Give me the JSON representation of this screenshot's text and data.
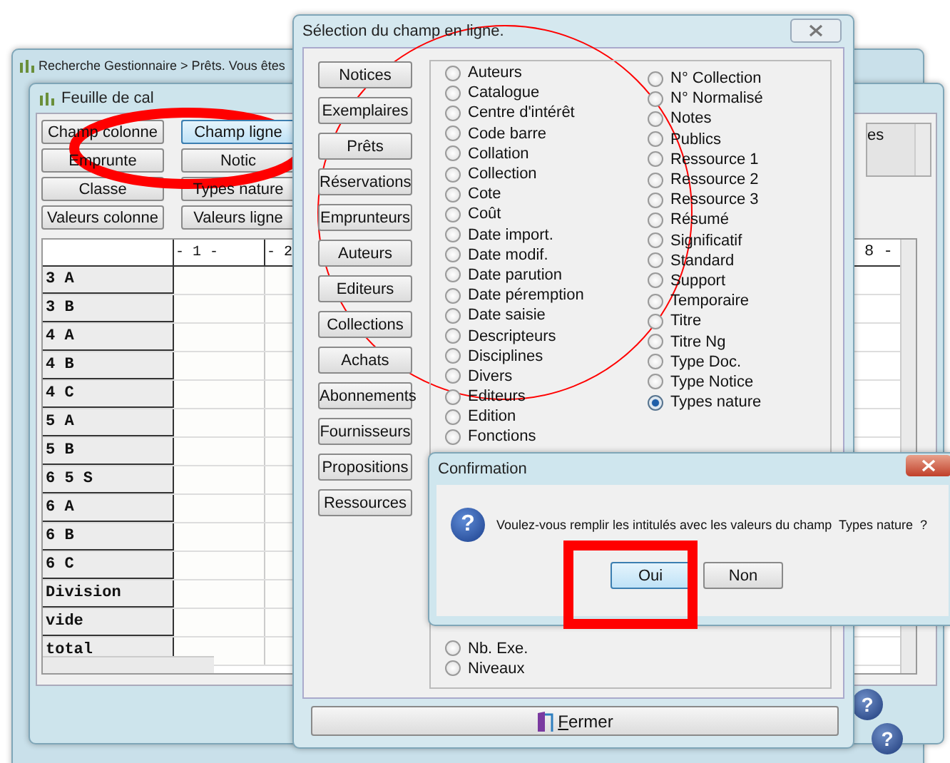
{
  "back_window": {
    "title": "Recherche Gestionnaire > Prêts.  Vous êtes"
  },
  "sheet_window": {
    "title": "Feuille de cal",
    "buttons": [
      {
        "label": "Champ colonne",
        "selected": false
      },
      {
        "label": "Champ ligne",
        "selected": true
      },
      {
        "label": "Emprunte",
        "selected": false
      },
      {
        "label": "Notic",
        "selected": false
      },
      {
        "label": "Classe",
        "selected": false
      },
      {
        "label": "Types nature",
        "selected": false
      },
      {
        "label": "Valeurs colonne",
        "selected": false
      },
      {
        "label": "Valeurs ligne",
        "selected": false
      }
    ],
    "side_list_text": "es",
    "table": {
      "columns": [
        "- 1 -",
        "- 2"
      ],
      "last_column": "8 -",
      "rows": [
        "3 A",
        "3 B",
        "4 A",
        "4 B",
        "4 C",
        "5 A",
        "5 B",
        "6 5 S",
        "6 A",
        "6 B",
        "6 C",
        "Division",
        "vide",
        "total"
      ]
    },
    "help_buttons": [
      "?",
      "?"
    ]
  },
  "selection_dialog": {
    "title": "Sélection du champ en ligne.",
    "categories": [
      "Notices",
      "Exemplaires",
      "Prêts",
      "Réservations",
      "Emprunteurs",
      "Auteurs",
      "Editeurs",
      "Collections",
      "Achats",
      "Abonnements",
      "Fournisseurs",
      "Propositions",
      "Ressources"
    ],
    "fields_column_1_top": [
      {
        "label": "Auteurs",
        "selected": false
      },
      {
        "label": "Catalogue",
        "selected": false
      },
      {
        "label": "Centre d'intérêt",
        "selected": false
      },
      {
        "label": "Code barre",
        "selected": false
      },
      {
        "label": "Collation",
        "selected": false
      },
      {
        "label": "Collection",
        "selected": false
      },
      {
        "label": "Cote",
        "selected": false
      },
      {
        "label": "Coût",
        "selected": false
      },
      {
        "label": "Date import.",
        "selected": false
      },
      {
        "label": "Date modif.",
        "selected": false
      },
      {
        "label": "Date parution",
        "selected": false
      },
      {
        "label": "Date péremption",
        "selected": false
      },
      {
        "label": "Date saisie",
        "selected": false
      },
      {
        "label": "Descripteurs",
        "selected": false
      },
      {
        "label": "Disciplines",
        "selected": false
      },
      {
        "label": "Divers",
        "selected": false
      },
      {
        "label": "Editeurs",
        "selected": false
      },
      {
        "label": "Edition",
        "selected": false
      },
      {
        "label": "Fonctions",
        "selected": false
      }
    ],
    "fields_column_1_bottom": [
      {
        "label": "Nb. Exe.",
        "selected": false
      },
      {
        "label": "Niveaux",
        "selected": false
      }
    ],
    "fields_column_2": [
      {
        "label": "N° Collection",
        "selected": false
      },
      {
        "label": "N° Normalisé",
        "selected": false
      },
      {
        "label": "Notes",
        "selected": false
      },
      {
        "label": "Publics",
        "selected": false
      },
      {
        "label": "Ressource 1",
        "selected": false
      },
      {
        "label": "Ressource 2",
        "selected": false
      },
      {
        "label": "Ressource 3",
        "selected": false
      },
      {
        "label": "Résumé",
        "selected": false
      },
      {
        "label": "Significatif",
        "selected": false
      },
      {
        "label": "Standard",
        "selected": false
      },
      {
        "label": "Support",
        "selected": false
      },
      {
        "label": "Temporaire",
        "selected": false
      },
      {
        "label": "Titre",
        "selected": false
      },
      {
        "label": "Titre Ng",
        "selected": false
      },
      {
        "label": "Type Doc.",
        "selected": false
      },
      {
        "label": "Type Notice",
        "selected": false
      },
      {
        "label": "Types nature",
        "selected": true
      }
    ],
    "close_button": "Fermer"
  },
  "confirmation": {
    "title": "Confirmation",
    "icon": "?",
    "message": "Voulez-vous remplir les intitulés avec les valeurs du champ  Types nature  ?",
    "buttons": [
      {
        "label": "Oui",
        "selected": true
      },
      {
        "label": "Non",
        "selected": false
      }
    ]
  },
  "annotations": [
    {
      "kind": "ellipse"
    },
    {
      "kind": "circle"
    },
    {
      "kind": "rectangle"
    }
  ]
}
